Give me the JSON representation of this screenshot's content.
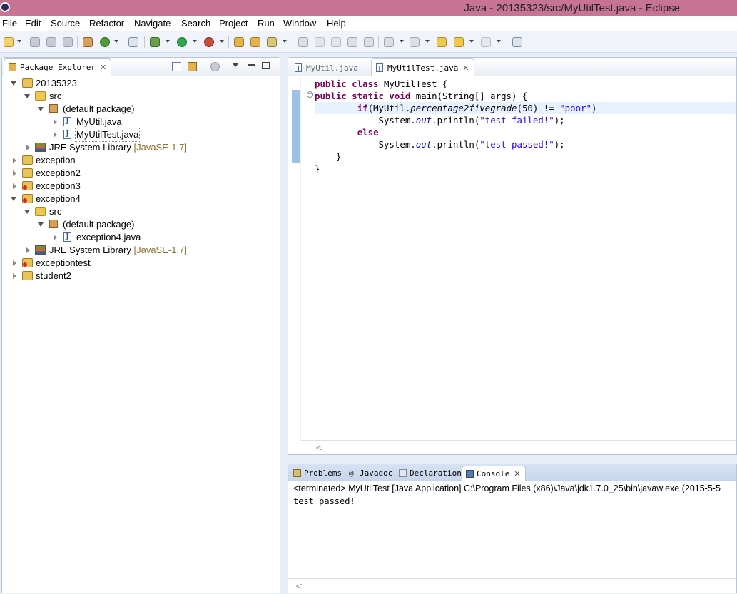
{
  "window": {
    "title": "Java - 20135323/src/MyUtilTest.java - Eclipse"
  },
  "menu": [
    "File",
    "Edit",
    "Source",
    "Refactor",
    "Navigate",
    "Search",
    "Project",
    "Run",
    "Window",
    "Help"
  ],
  "explorer": {
    "tab_label": "Package Explorer",
    "tree": [
      {
        "label": "20135323",
        "lib": ""
      },
      {
        "label": "src",
        "lib": ""
      },
      {
        "label": "(default package)",
        "lib": ""
      },
      {
        "label": "MyUtil.java",
        "lib": ""
      },
      {
        "label": "MyUtilTest.java",
        "lib": ""
      },
      {
        "label": "JRE System Library ",
        "lib": "[JavaSE-1.7]"
      },
      {
        "label": "exception",
        "lib": ""
      },
      {
        "label": "exception2",
        "lib": ""
      },
      {
        "label": "exception3",
        "lib": ""
      },
      {
        "label": "exception4",
        "lib": ""
      },
      {
        "label": "src",
        "lib": ""
      },
      {
        "label": "(default package)",
        "lib": ""
      },
      {
        "label": "exception4.java",
        "lib": ""
      },
      {
        "label": "JRE System Library ",
        "lib": "[JavaSE-1.7]"
      },
      {
        "label": "exceptiontest",
        "lib": ""
      },
      {
        "label": "student2",
        "lib": ""
      }
    ]
  },
  "editor": {
    "tabs": [
      {
        "label": "MyUtil.java"
      },
      {
        "label": "MyUtilTest.java"
      }
    ],
    "code": {
      "l1_kw": "public class",
      "l1_rest": " MyUtilTest {",
      "l2_kw": "public static void",
      "l2_rest": " main(String[] args) {",
      "l3_indent": "        ",
      "l3_kw": "if",
      "l3_a": "(MyUtil.",
      "l3_method": "percentage2fivegrade",
      "l3_b": "(50) != ",
      "l3_str": "\"poor\"",
      "l3_c": ")",
      "l4_a": "            System.",
      "l4_field": "out",
      "l4_b": ".println(",
      "l4_str": "\"test failed!\"",
      "l4_c": ");",
      "l5_indent": "        ",
      "l5_kw": "else",
      "l6_a": "            System.",
      "l6_field": "out",
      "l6_b": ".println(",
      "l6_str": "\"test passed!\"",
      "l6_c": ");",
      "l7": "    }",
      "l8": "}"
    }
  },
  "console": {
    "tabs": [
      {
        "label": "Problems"
      },
      {
        "label": "Javadoc"
      },
      {
        "label": "Declaration"
      },
      {
        "label": "Console"
      }
    ],
    "status": "<terminated> MyUtilTest [Java Application] C:\\Program Files (x86)\\Java\\jdk1.7.0_25\\bin\\javaw.exe (2015-5-5",
    "output": "test passed!"
  }
}
